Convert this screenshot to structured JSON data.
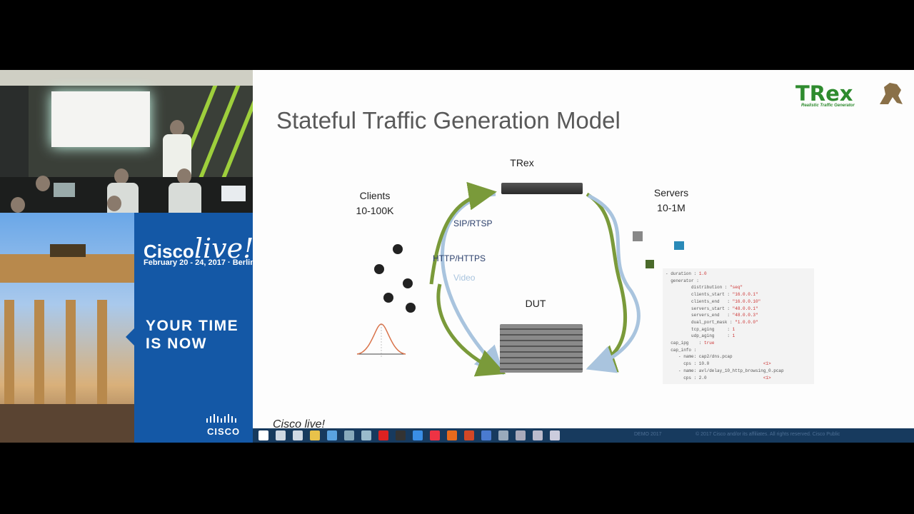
{
  "slide": {
    "title": "Stateful Traffic Generation Model",
    "logo": {
      "text": "TRex",
      "tagline": "Realistic Traffic Generator",
      "color": "#2e8b2e"
    },
    "clients": {
      "title": "Clients",
      "range": "10-100K"
    },
    "trex_label": "TRex",
    "dut_label": "DUT",
    "servers": {
      "title": "Servers",
      "range": "10-1M"
    },
    "protocols": [
      "SIP/RTSP",
      "HTTP/HTTPS",
      "Video"
    ],
    "server_icons": [
      "Domain",
      "Computer",
      "Site"
    ],
    "user_icon_label": "User",
    "code_lines": [
      [
        "- duration : ",
        "1.0"
      ],
      [
        "  generator :",
        ""
      ],
      [
        "          distribution : ",
        "\"seq\""
      ],
      [
        "          clients_start : ",
        "\"16.0.0.1\""
      ],
      [
        "          clients_end   : ",
        "\"16.0.0.10\""
      ],
      [
        "          servers_start : ",
        "\"48.0.0.1\""
      ],
      [
        "          servers_end   : ",
        "\"48.0.0.3\""
      ],
      [
        "          dual_port_mask : ",
        "\"1.0.0.0\""
      ],
      [
        "          tcp_aging     : ",
        "1"
      ],
      [
        "          udp_aging     : ",
        "1"
      ],
      [
        "  cap_ipg    : ",
        "true"
      ],
      [
        "  cap_info :",
        ""
      ],
      [
        "     - name: cap2/dns.pcap",
        ""
      ],
      [
        "       cps : 10.0                     ",
        "<1>"
      ],
      [
        "     - name: avl/delay_10_http_browsing_0.pcap",
        ""
      ],
      [
        "       cps : 2.0                      ",
        "<1>"
      ]
    ]
  },
  "promo": {
    "brand": "Cisco",
    "brand_live": "live!",
    "event_date": "February 20 - 24, 2017 · Berlin",
    "tagline": "YOUR TIME IS NOW",
    "cisco_logo": "CISCO"
  },
  "watermark": "Cisco live!",
  "taskbar": {
    "icons": [
      "start-icon",
      "search-icon",
      "task-view-icon",
      "explorer-icon",
      "store-icon",
      "app-icon",
      "app-icon",
      "acrobat-icon",
      "terminal-icon",
      "ie-icon",
      "chrome-icon",
      "office-icon",
      "powerpoint-icon",
      "app-icon",
      "app-icon",
      "app-icon",
      "app-icon",
      "app-icon"
    ],
    "tray_text_1": "DEMO 2017",
    "tray_text_2": "© 2017 Cisco and/or its affiliates. All rights reserved.   Cisco Public"
  },
  "colors": {
    "promo_blue": "#1458a6",
    "arrow_green": "#7a9a3a",
    "arrow_blue": "#a9c4de",
    "taskbar": "#173a5e"
  }
}
